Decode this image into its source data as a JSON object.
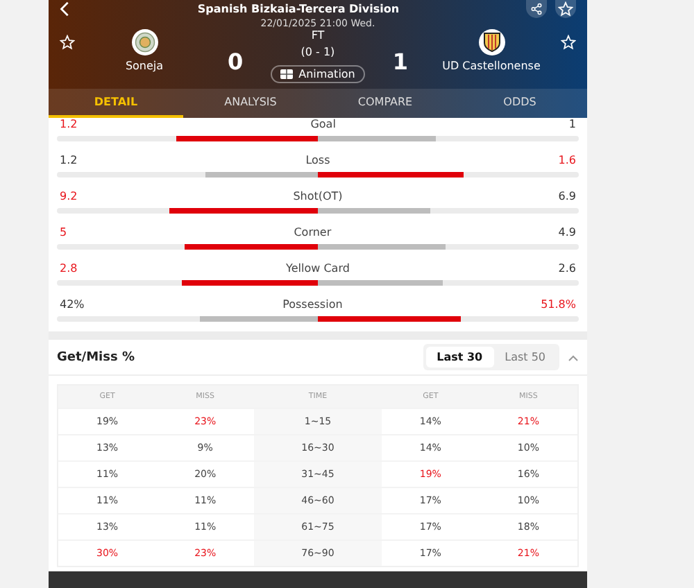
{
  "header": {
    "league": "Spanish Bizkaia-Tercera Division",
    "datetime": "22/01/2025 21:00 Wed.",
    "home": {
      "name": "Soneja",
      "score": "0",
      "favorite": false
    },
    "away": {
      "name": "UD Castellonense",
      "score": "1",
      "favorite": false
    },
    "status": "FT",
    "half_time": "(0 - 1)",
    "animation_label": "Animation"
  },
  "tabs": [
    {
      "label": "DETAIL",
      "selected": true
    },
    {
      "label": "ANALYSIS",
      "selected": false
    },
    {
      "label": "COMPARE",
      "selected": false
    },
    {
      "label": "ODDS",
      "selected": false
    }
  ],
  "stats": [
    {
      "label": "Goal",
      "home": {
        "value": "1.2",
        "level": 0.54,
        "highlight": true
      },
      "away": {
        "value": "1",
        "level": 0.45,
        "highlight": false
      }
    },
    {
      "label": "Loss",
      "home": {
        "value": "1.2",
        "level": 0.43,
        "highlight": false
      },
      "away": {
        "value": "1.6",
        "level": 0.56,
        "highlight": true
      }
    },
    {
      "label": "Shot(OT)",
      "home": {
        "value": "9.2",
        "level": 0.57,
        "highlight": true
      },
      "away": {
        "value": "6.9",
        "level": 0.43,
        "highlight": false
      }
    },
    {
      "label": "Corner",
      "home": {
        "value": "5",
        "level": 0.51,
        "highlight": true
      },
      "away": {
        "value": "4.9",
        "level": 0.49,
        "highlight": false
      }
    },
    {
      "label": "Yellow Card",
      "home": {
        "value": "2.8",
        "level": 0.52,
        "highlight": true
      },
      "away": {
        "value": "2.6",
        "level": 0.48,
        "highlight": false
      }
    },
    {
      "label": "Possession",
      "home": {
        "value": "42%",
        "level": 0.45,
        "highlight": false
      },
      "away": {
        "value": "51.8%",
        "level": 0.55,
        "highlight": true
      }
    }
  ],
  "get_miss": {
    "title": "Get/Miss %",
    "ranges": [
      {
        "label": "Last 30",
        "selected": true
      },
      {
        "label": "Last 50",
        "selected": false
      }
    ],
    "expanded": true,
    "columns": [
      "GET",
      "MISS",
      "TIME",
      "GET",
      "MISS"
    ],
    "rows": [
      [
        {
          "text": "19%",
          "highlight": false
        },
        {
          "text": "23%",
          "highlight": true
        },
        {
          "text": "1~15",
          "highlight": false
        },
        {
          "text": "14%",
          "highlight": false
        },
        {
          "text": "21%",
          "highlight": true
        }
      ],
      [
        {
          "text": "13%",
          "highlight": false
        },
        {
          "text": "9%",
          "highlight": false
        },
        {
          "text": "16~30",
          "highlight": false
        },
        {
          "text": "14%",
          "highlight": false
        },
        {
          "text": "10%",
          "highlight": false
        }
      ],
      [
        {
          "text": "11%",
          "highlight": false
        },
        {
          "text": "20%",
          "highlight": false
        },
        {
          "text": "31~45",
          "highlight": false
        },
        {
          "text": "19%",
          "highlight": true
        },
        {
          "text": "16%",
          "highlight": false
        }
      ],
      [
        {
          "text": "11%",
          "highlight": false
        },
        {
          "text": "11%",
          "highlight": false
        },
        {
          "text": "46~60",
          "highlight": false
        },
        {
          "text": "17%",
          "highlight": false
        },
        {
          "text": "10%",
          "highlight": false
        }
      ],
      [
        {
          "text": "13%",
          "highlight": false
        },
        {
          "text": "11%",
          "highlight": false
        },
        {
          "text": "61~75",
          "highlight": false
        },
        {
          "text": "17%",
          "highlight": false
        },
        {
          "text": "18%",
          "highlight": false
        }
      ],
      [
        {
          "text": "30%",
          "highlight": true
        },
        {
          "text": "23%",
          "highlight": true
        },
        {
          "text": "76~90",
          "highlight": false
        },
        {
          "text": "17%",
          "highlight": false
        },
        {
          "text": "21%",
          "highlight": true
        }
      ]
    ]
  }
}
